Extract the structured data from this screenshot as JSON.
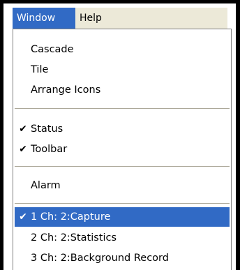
{
  "menubar": {
    "items": [
      {
        "label": "Window"
      },
      {
        "label": "Help"
      }
    ]
  },
  "menu": {
    "items": [
      {
        "label": "Cascade"
      },
      {
        "label": "Tile"
      },
      {
        "label": "Arrange Icons"
      },
      {
        "label": "Status",
        "checked": true
      },
      {
        "label": "Toolbar",
        "checked": true
      },
      {
        "label": "Alarm"
      },
      {
        "label": "1 Ch: 2:Capture",
        "checked": true,
        "selected": true
      },
      {
        "label": "2 Ch: 2:Statistics"
      },
      {
        "label": "3 Ch: 2:Background Record"
      }
    ],
    "check_glyph": "✔",
    "colors": {
      "highlight": "#316ac5",
      "menubar_bg": "#ece9d8",
      "separator": "#aca899"
    }
  }
}
